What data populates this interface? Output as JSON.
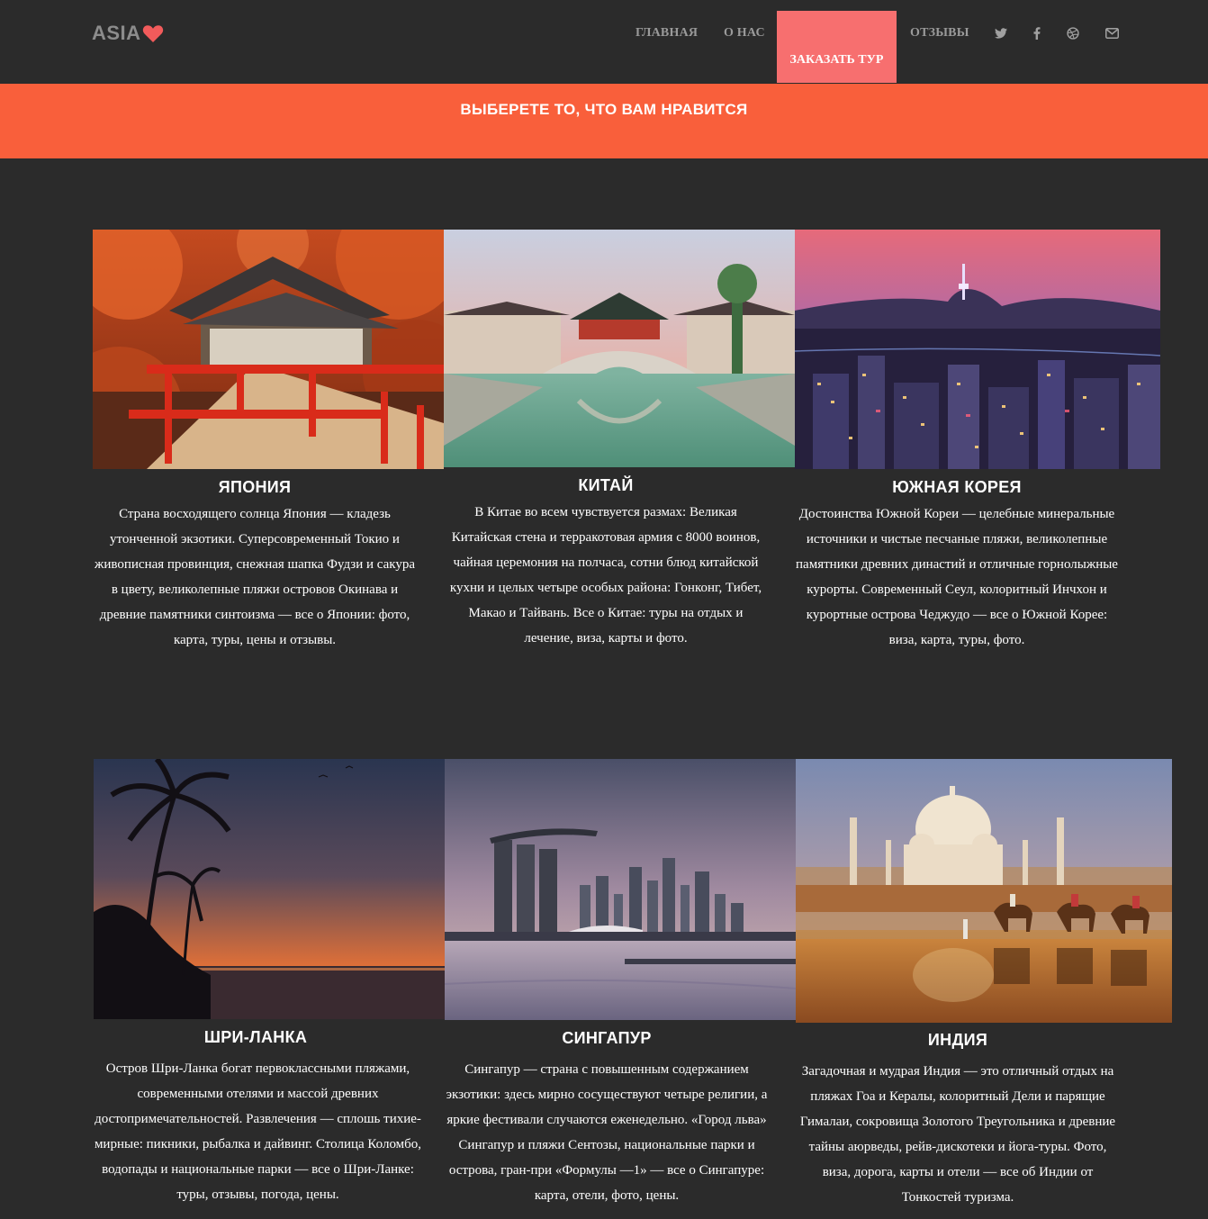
{
  "header": {
    "logo_text": "ASIA",
    "logo_icon": "heart-icon",
    "nav": [
      "ГЛАВНАЯ",
      "О НАС",
      "ЗАКАЗАТЬ ТУР",
      "ОТЗЫВЫ"
    ],
    "social_icons": [
      "twitter-icon",
      "facebook-icon",
      "dribbble-icon",
      "mail-icon"
    ]
  },
  "banner": {
    "title": "ВЫБЕРЕТЕ ТО, ЧТО ВАМ НРАВИТСЯ"
  },
  "colors": {
    "background": "#2b2b2b",
    "banner": "#f95f3b",
    "cta": "#f76f6f",
    "heart": "#f25b5b"
  },
  "destinations": [
    {
      "title": "ЯПОНИЯ",
      "text": "Страна восходящего солнца Япония — кладезь утонченной экзотики. Суперсовременный Токио и живописная провинция, снежная шапка Фудзи и сакура в цвету, великолепные пляжи островов Окинава и древние памятники синтоизма — все о Японии: фото, карта, туры, цены и отзывы."
    },
    {
      "title": "КИТАЙ",
      "text": "В Китае во всем чувствуется размах: Великая Китайская стена и терракотовая армия с 8000 воинов, чайная церемония на полчаса, сотни блюд китайской кухни и целых четыре особых района: Гонконг, Тибет, Макао и Тайвань. Все о Китае: туры на отдых и лечение, виза, карты и фото."
    },
    {
      "title": "ЮЖНАЯ КОРЕЯ",
      "text": "Достоинства Южной Кореи — целебные минеральные источники и чистые песчаные пляжи, великолепные памятники древних династий и отличные горнолыжные курорты. Современный Сеул, колоритный Инчхон и курортные острова Чеджудо — все о Южной Корее: виза, карта, туры, фото."
    },
    {
      "title": "ШРИ-ЛАНКА",
      "text": "Остров Шри-Ланка богат первоклассными пляжами, современными отелями и массой древних достопримечательностей. Развлечения — сплошь тихие-мирные: пикники, рыбалка и дайвинг. Столица Коломбо, водопады и национальные парки — все о Шри-Ланке: туры, отзывы, погода, цены."
    },
    {
      "title": "СИНГАПУР",
      "text": "Сингапур — страна с повышенным содержанием экзотики: здесь мирно сосуществуют четыре религии, а яркие фестивали случаются еженедельно. «Город льва» Сингапур и пляжи Сентозы, национальные парки и острова, гран-при «Формулы —1» — все о Сингапуре: карта, отели, фото, цены."
    },
    {
      "title": "ИНДИЯ",
      "text": "Загадочная и мудрая Индия — это отличный отдых на пляжах Гоа и Кералы, колоритный Дели и парящие Гималаи, сокровища Золотого Треугольника и древние тайны аюрведы, рейв-дискотеки и йога-туры. Фото, виза, дорога, карты и отели — все об Индии от Тонкостей туризма."
    }
  ]
}
